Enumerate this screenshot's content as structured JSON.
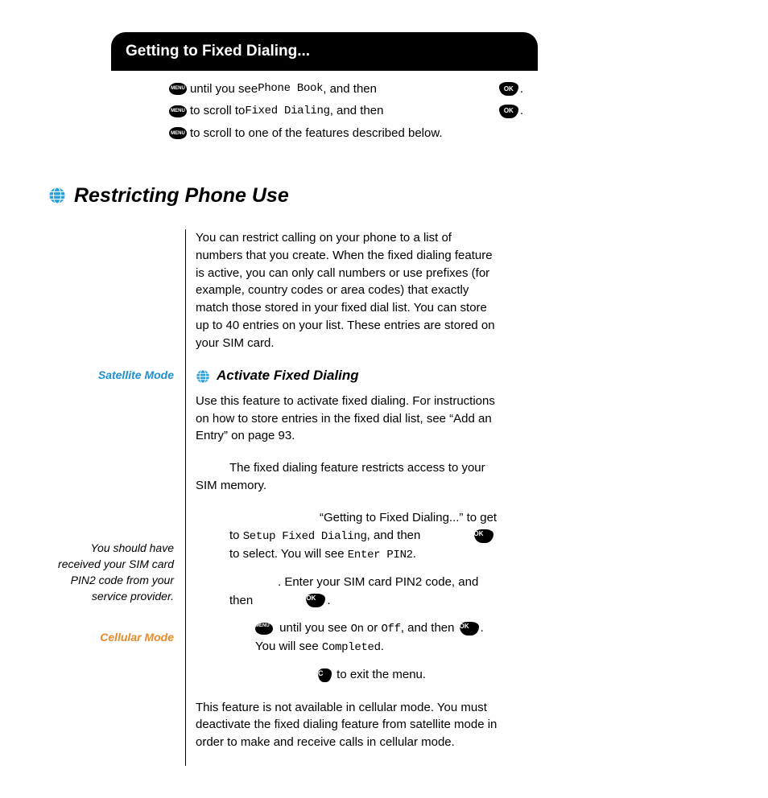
{
  "navBox": {
    "title": "Getting to Fixed Dialing...",
    "line1_a": " until you see ",
    "line1_mono": "Phone Book",
    "line1_b": ", and then ",
    "line2_a": " to scroll to ",
    "line2_mono": "Fixed Dialing",
    "line2_b": ", and then ",
    "line3": " to scroll to one of the features described below.",
    "menuLabel": "MENU",
    "okLabel": "OK"
  },
  "mainHeading": "Restricting Phone Use",
  "intro": "You can restrict calling on your phone to a list of numbers that you create. When the fixed dialing feature is active, you can only call numbers or use prefixes (for example, country codes or area codes) that exactly match those stored in your fixed dial list. You can store up to 40 entries on your list. These entries are stored on your SIM card.",
  "subHeading": "Activate Fixed Dialing",
  "satMode": "Satellite Mode",
  "satPara1": "Use this feature to activate fixed dialing. For instructions on how to store entries in the fixed dial list, see “Add an Entry” on page 93.",
  "satPara2": "The fixed dialing feature restricts access to your SIM memory.",
  "step1a": "“Getting to Fixed Dialing...” to get to ",
  "step1mono": "Setup Fixed Dialing",
  "step1b": ", and then ",
  "step1c": " to select. You will see ",
  "step1mono2": "Enter PIN2",
  "step2a": ". Enter your SIM card PIN2 code, and then ",
  "step3a": " until you see ",
  "step3mono": "On",
  "step3b": " or ",
  "step3mono2": "Off",
  "step3c": ", and then ",
  "step3d": ". You will see ",
  "step3mono3": "Completed",
  "step4": " to exit the menu.",
  "tipNote": "You should have received your SIM card PIN2 code from your service provider.",
  "cellMode": "Cellular Mode",
  "cellPara": "This feature is not available in cellular mode. You must deactivate the fixed dialing feature from satellite mode in order to make and receive calls in cellular mode.",
  "okLabel": "OK",
  "menuLabel": "MENU",
  "cLabel": "C"
}
